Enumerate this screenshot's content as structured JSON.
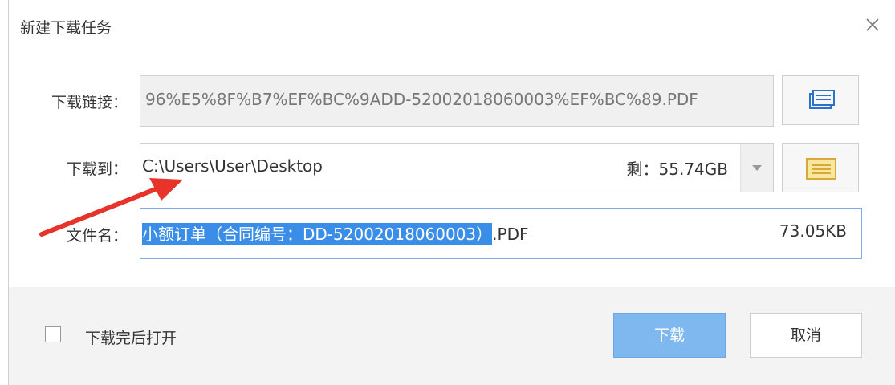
{
  "dialog": {
    "title": "新建下载任务",
    "close_icon": "close-icon"
  },
  "url": {
    "label": "下载链接：",
    "value": "96%E5%8F%B7%EF%BC%9ADD-52002018060003%EF%BC%89.PDF",
    "button_icon": "copy-link-icon"
  },
  "save_to": {
    "label": "下载到：",
    "path": "C:\\Users\\User\\Desktop",
    "free_space": "剩：55.74GB",
    "button_icon": "folder-icon"
  },
  "filename": {
    "label": "文件名：",
    "selected_part": "小额订单（合同编号：DD-52002018060003）",
    "extension": ".PDF",
    "size": "73.05KB"
  },
  "footer": {
    "open_after_label": "下载完后打开",
    "open_after_checked": false,
    "download_label": "下载",
    "cancel_label": "取消"
  },
  "colors": {
    "primary_button": "#7fb8ee",
    "selection": "#3b8ee8",
    "annotation_arrow": "#e8332a"
  }
}
